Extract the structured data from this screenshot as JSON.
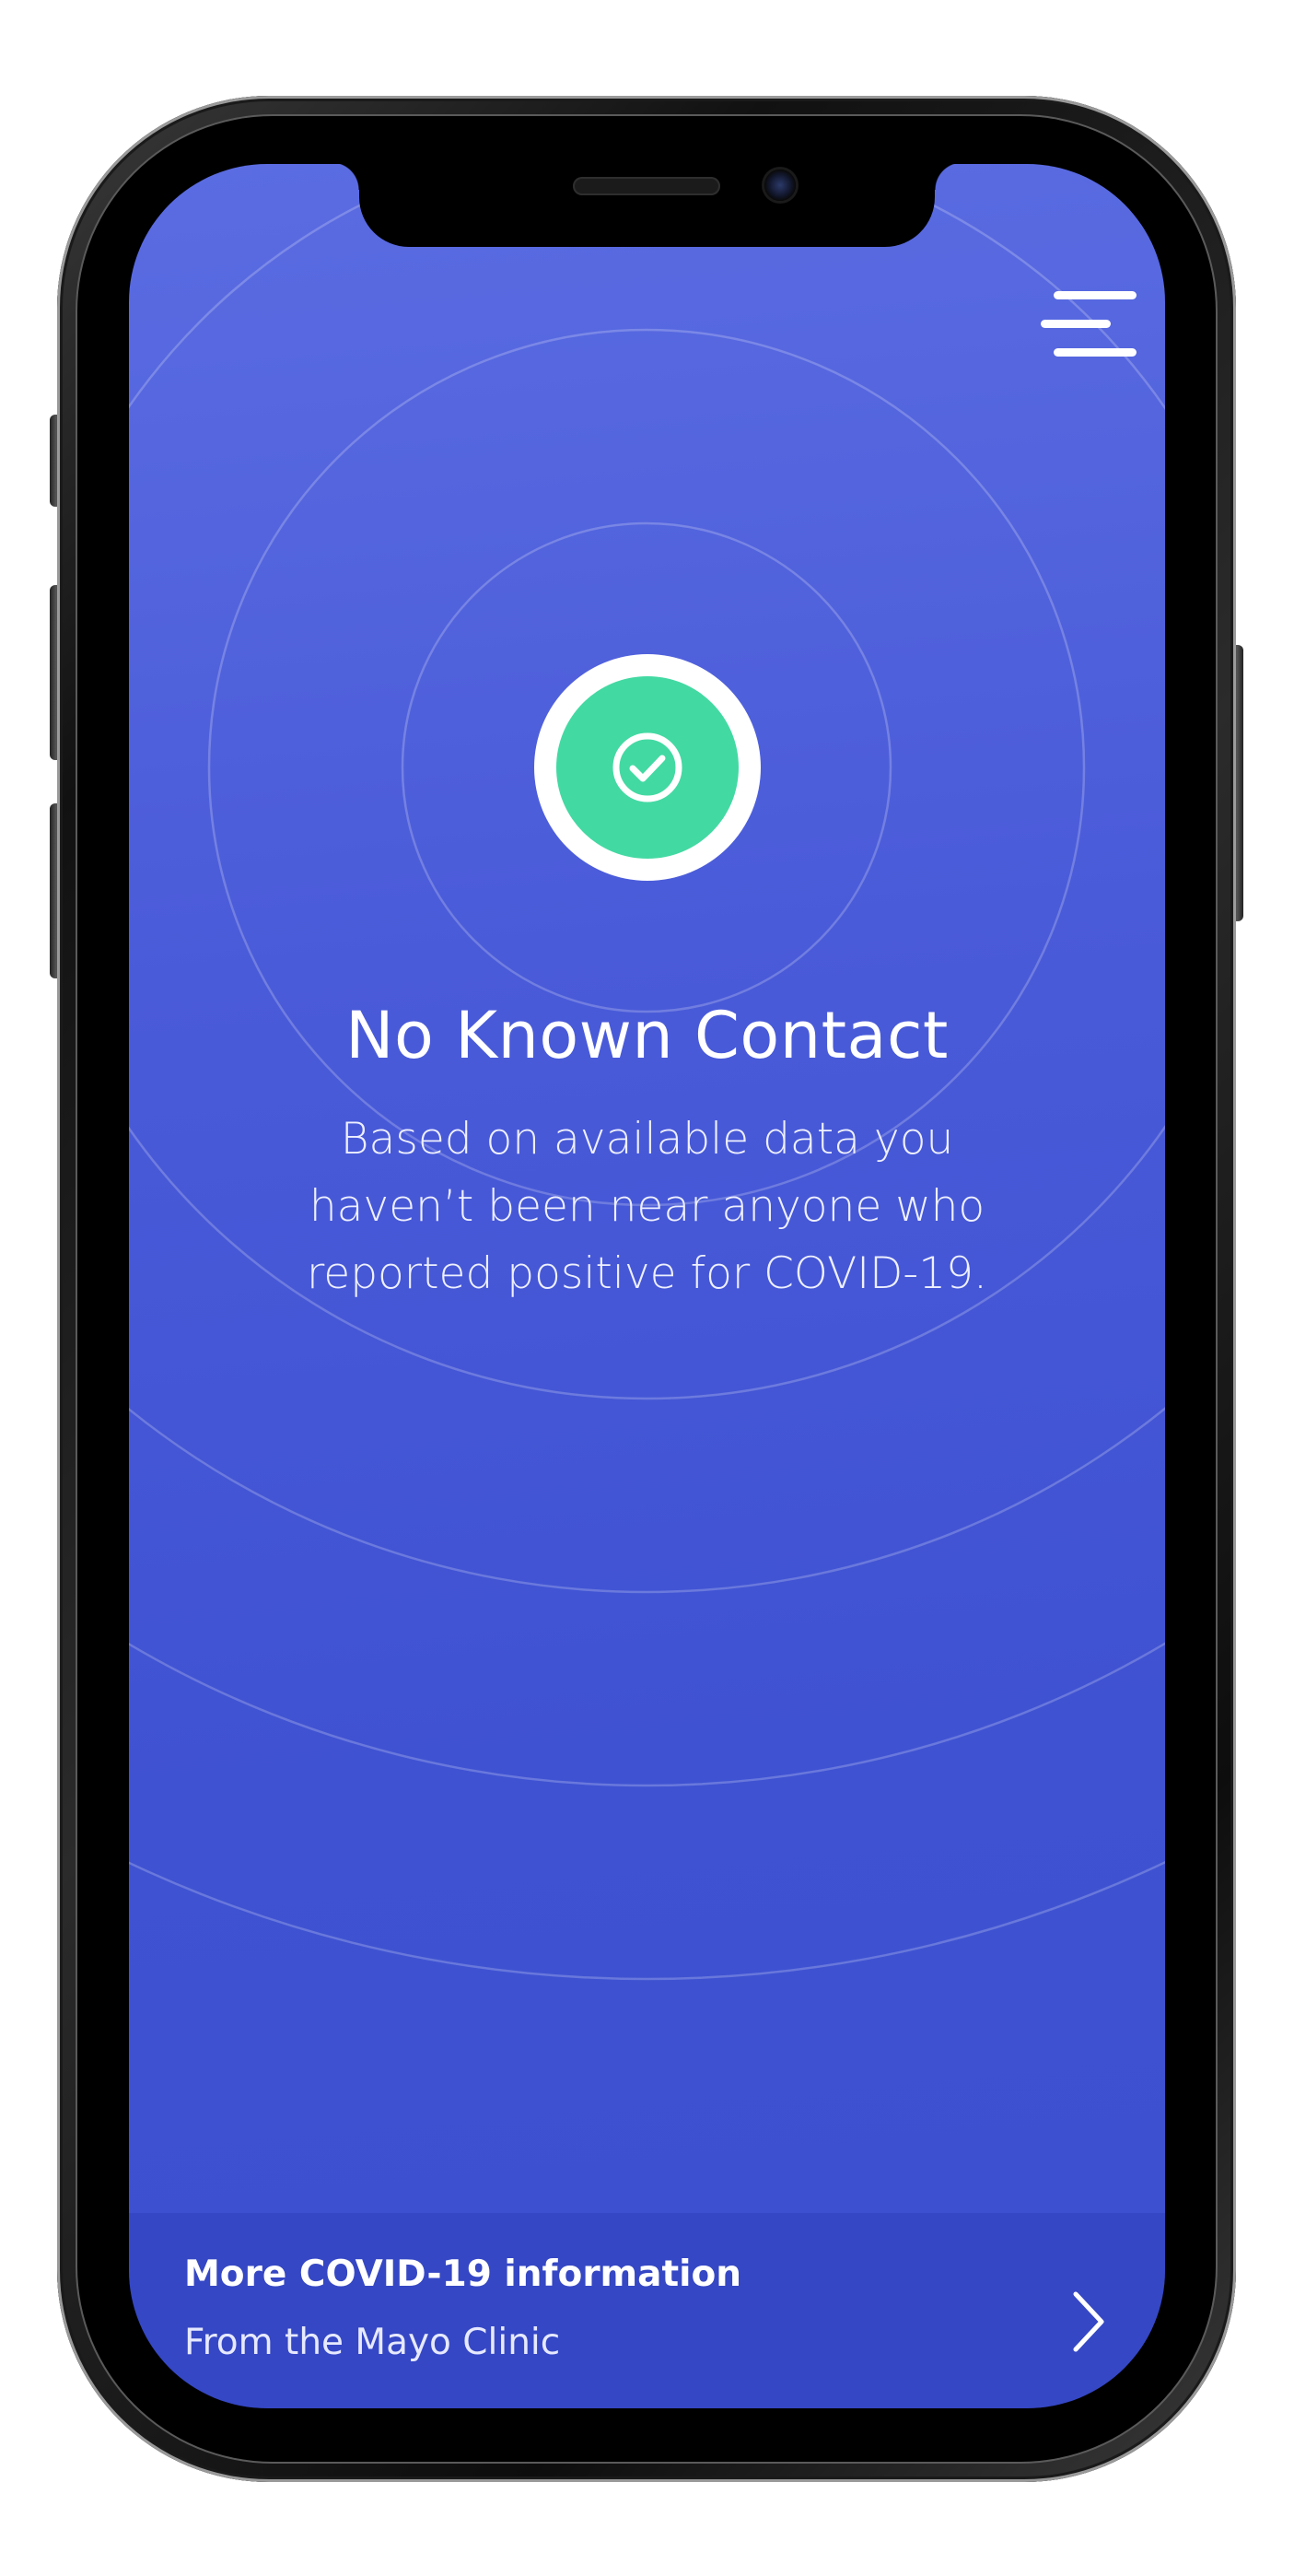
{
  "status": {
    "title": "No Known Contact",
    "description": "Based on available data you haven’t been near anyone who reported positive for COVID-19.",
    "icon": "check-circle-icon",
    "color": "#43d9a3"
  },
  "menu": {
    "icon": "hamburger-menu-icon"
  },
  "info_card": {
    "title": "More COVID-19 information",
    "subtitle": "From the Mayo Clinic",
    "icon": "chevron-right-icon"
  },
  "theme": {
    "background": "#4a5bd9",
    "accent": "#43d9a3"
  }
}
